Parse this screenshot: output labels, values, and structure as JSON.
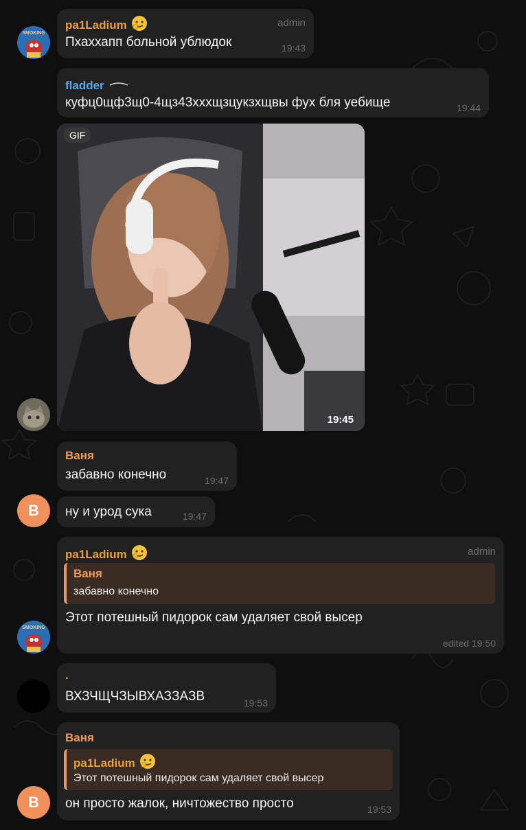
{
  "messages": [
    {
      "name": "pa1Ladium",
      "badge": "admin",
      "text": "Пхаххапп больной ублюдок",
      "time": "19:43"
    },
    {
      "name": "fladder",
      "text": "куфц0щф3щ0-4щз43хххщзцукзхщвы фух бля уебище",
      "time": "19:44"
    },
    {
      "gif_label": "GIF",
      "time": "19:45"
    },
    {
      "name": "Ваня",
      "text": "забавно конечно",
      "time": "19:47"
    },
    {
      "text": "ну и урод сука",
      "time": "19:47"
    },
    {
      "name": "pa1Ladium",
      "badge": "admin",
      "reply_name": "Ваня",
      "reply_text": "забавно конечно",
      "text": "Этот потешный пидорок сам удаляет свой высер",
      "time": "edited 19:50"
    },
    {
      "name": ".",
      "text": "ВХЗЧЩЧЗЫВХАЗЗАЗВ",
      "time": "19:53"
    },
    {
      "name": "Ваня",
      "reply_name": "pa1Ladium",
      "reply_text": "Этот потешный пидорок сам удаляет свой высер",
      "text": "он просто жалок, ничтожество просто",
      "time": "19:53"
    }
  ],
  "avatars": {
    "vanya_letter": "В",
    "smoking_text": "SMOKING"
  },
  "colors": {
    "pa1ladium_name": "#e8a13a",
    "fladder_name": "#62a6e0",
    "vanya_name": "#ef9a59",
    "dot_user_name": "#e8a13a",
    "bubble": "#212121",
    "background": "#0f0f0f"
  }
}
